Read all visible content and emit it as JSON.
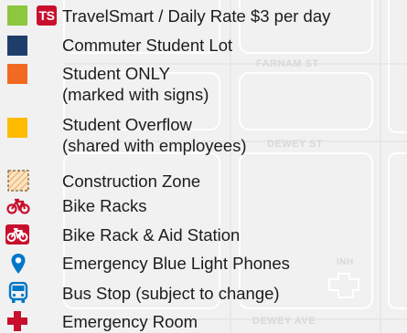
{
  "map": {
    "streets": [
      "FARNAM ST",
      "DEWEY ST",
      "DEWEY AVE",
      "INH"
    ]
  },
  "legend": {
    "items": [
      {
        "icon": "travelsmart-ts-badge",
        "badge": "TS",
        "label": "TravelSmart / Daily Rate $3 per day",
        "color": "#8dc63f"
      },
      {
        "icon": "commuter-lot-swatch",
        "label": "Commuter Student Lot",
        "color": "#1f3d6b"
      },
      {
        "icon": "student-only-swatch",
        "label_line1": "Student ONLY",
        "label_line2": "(marked with signs)",
        "color": "#f26a21"
      },
      {
        "icon": "student-overflow-swatch",
        "label_line1": "Student Overflow",
        "label_line2": "(shared with employees)",
        "color": "#ffbb00"
      },
      {
        "icon": "construction-zone-swatch",
        "label": "Construction Zone",
        "color": "#f6c98a"
      },
      {
        "icon": "bike-icon",
        "label": "Bike Racks",
        "color": "#c8102e"
      },
      {
        "icon": "bike-aid-icon",
        "label": "Bike Rack & Aid Station",
        "color": "#c8102e"
      },
      {
        "icon": "location-pin-icon",
        "label": "Emergency Blue Light Phones",
        "color": "#0077c8"
      },
      {
        "icon": "bus-icon",
        "label": "Bus Stop (subject to change)",
        "color": "#0077c8"
      },
      {
        "icon": "cross-icon",
        "label": "Emergency Room",
        "color": "#c8102e"
      }
    ]
  }
}
